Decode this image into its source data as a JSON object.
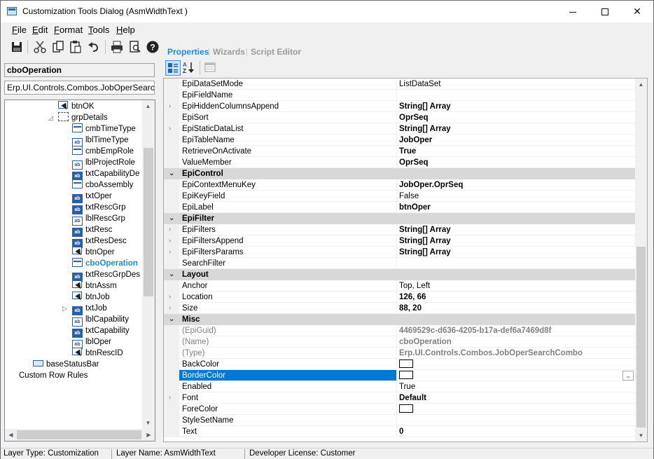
{
  "window": {
    "title": "Customization Tools Dialog  (AsmWidthText )"
  },
  "menu": [
    {
      "label": "File",
      "key": "F",
      "rest": "ile"
    },
    {
      "label": "Edit",
      "key": "E",
      "rest": "dit"
    },
    {
      "label": "Format",
      "key": "F",
      "rest": "ormat"
    },
    {
      "label": "Tools",
      "key": "T",
      "rest": "ools"
    },
    {
      "label": "Help",
      "key": "H",
      "rest": "elp"
    }
  ],
  "toolbar": {
    "buttons": [
      "save-icon",
      "cut-icon",
      "copy-icon",
      "paste-icon",
      "undo-icon",
      "print-icon",
      "print-preview-icon",
      "help-icon"
    ]
  },
  "left": {
    "control_name": "cboOperation",
    "control_type": "Erp.UI.Controls.Combos.JobOperSearch"
  },
  "tree": {
    "items": [
      {
        "label": "btnOK",
        "icon": "button-icon",
        "indent": 3
      },
      {
        "label": "grpDetails",
        "icon": "groupbox-icon",
        "indent": 3,
        "expander": "◿"
      },
      {
        "label": "cmbTimeType",
        "icon": "combo-icon",
        "indent": 4
      },
      {
        "label": "lblTimeType",
        "icon": "label-icon",
        "indent": 4
      },
      {
        "label": "cmbEmpRole",
        "icon": "combo-icon",
        "indent": 4
      },
      {
        "label": "lblProjectRole",
        "icon": "label-icon",
        "indent": 4
      },
      {
        "label": "txtCapabilityDe",
        "icon": "textbox-icon",
        "indent": 4
      },
      {
        "label": "cboAssembly",
        "icon": "combo-icon",
        "indent": 4
      },
      {
        "label": "txtOper",
        "icon": "textbox-icon",
        "indent": 4
      },
      {
        "label": "txtRescGrp",
        "icon": "textbox-icon",
        "indent": 4
      },
      {
        "label": "lblRescGrp",
        "icon": "label-icon",
        "indent": 4
      },
      {
        "label": "txtResc",
        "icon": "textbox-icon",
        "indent": 4
      },
      {
        "label": "txtResDesc",
        "icon": "textbox-icon",
        "indent": 4
      },
      {
        "label": "btnOper",
        "icon": "button-icon",
        "indent": 4
      },
      {
        "label": "cboOperation",
        "icon": "combo-icon",
        "indent": 4,
        "selected": true
      },
      {
        "label": "txtRescGrpDes",
        "icon": "textbox-icon",
        "indent": 4
      },
      {
        "label": "btnAssm",
        "icon": "button-icon",
        "indent": 4
      },
      {
        "label": "btnJob",
        "icon": "button-icon",
        "indent": 4
      },
      {
        "label": "txtJob",
        "icon": "textbox-icon",
        "indent": 4,
        "expander": "▷"
      },
      {
        "label": "lblCapability",
        "icon": "label-icon",
        "indent": 4
      },
      {
        "label": "txtCapability",
        "icon": "textbox-icon",
        "indent": 4
      },
      {
        "label": "lblOper",
        "icon": "label-icon",
        "indent": 4
      },
      {
        "label": "btnRescID",
        "icon": "button-icon",
        "indent": 4
      },
      {
        "label": "baseStatusBar",
        "icon": "statusbar-icon",
        "indent": 2
      },
      {
        "label": "Custom Row Rules",
        "icon": "",
        "indent": 1
      }
    ]
  },
  "tabs": [
    {
      "label": "Properties",
      "active": true
    },
    {
      "label": "Wizards",
      "active": false
    },
    {
      "label": "Script Editor",
      "active": false
    }
  ],
  "grid": {
    "rows": [
      {
        "type": "prop",
        "name": "EpiDataSetMode",
        "value": "ListDataSet"
      },
      {
        "type": "prop",
        "name": "EpiFieldName",
        "value": ""
      },
      {
        "type": "prop",
        "name": "EpiHiddenColumnsAppend",
        "value": "String[] Array",
        "bold": true,
        "expander": true
      },
      {
        "type": "prop",
        "name": "EpiSort",
        "value": "OprSeq",
        "bold": true
      },
      {
        "type": "prop",
        "name": "EpiStaticDataList",
        "value": "String[] Array",
        "bold": true,
        "expander": true
      },
      {
        "type": "prop",
        "name": "EpiTableName",
        "value": "JobOper",
        "bold": true
      },
      {
        "type": "prop",
        "name": "RetrieveOnActivate",
        "value": "True",
        "bold": true
      },
      {
        "type": "prop",
        "name": "ValueMember",
        "value": "OprSeq",
        "bold": true
      },
      {
        "type": "category",
        "name": "EpiControl"
      },
      {
        "type": "prop",
        "name": "EpiContextMenuKey",
        "value": "JobOper.OprSeq",
        "bold": true
      },
      {
        "type": "prop",
        "name": "EpiKeyField",
        "value": "False"
      },
      {
        "type": "prop",
        "name": "EpiLabel",
        "value": "btnOper",
        "bold": true
      },
      {
        "type": "category",
        "name": "EpiFilter"
      },
      {
        "type": "prop",
        "name": "EpiFilters",
        "value": "String[] Array",
        "bold": true,
        "expander": true
      },
      {
        "type": "prop",
        "name": "EpiFiltersAppend",
        "value": "String[] Array",
        "bold": true,
        "expander": true
      },
      {
        "type": "prop",
        "name": "EpiFiltersParams",
        "value": "String[] Array",
        "bold": true,
        "expander": true
      },
      {
        "type": "prop",
        "name": "SearchFilter",
        "value": ""
      },
      {
        "type": "category",
        "name": "Layout"
      },
      {
        "type": "prop",
        "name": "Anchor",
        "value": "Top, Left"
      },
      {
        "type": "prop",
        "name": "Location",
        "value": "126, 66",
        "bold": true,
        "expander": true
      },
      {
        "type": "prop",
        "name": "Size",
        "value": "88, 20",
        "bold": true,
        "expander": true
      },
      {
        "type": "category",
        "name": "Misc"
      },
      {
        "type": "prop",
        "name": "(EpiGuid)",
        "value": "4469529c-d636-4205-b17a-def6a7469d8f",
        "readonly": true,
        "bold": true
      },
      {
        "type": "prop",
        "name": "(Name)",
        "value": "cboOperation",
        "readonly": true,
        "bold": true
      },
      {
        "type": "prop",
        "name": "(Type)",
        "value": "Erp.UI.Controls.Combos.JobOperSearchCombo",
        "readonly": true,
        "bold": true
      },
      {
        "type": "prop",
        "name": "BackColor",
        "value": "",
        "swatch": true
      },
      {
        "type": "prop",
        "name": "BorderColor",
        "value": "",
        "swatch": true,
        "selected": true,
        "dropdown": true
      },
      {
        "type": "prop",
        "name": "Enabled",
        "value": "True"
      },
      {
        "type": "prop",
        "name": "Font",
        "value": "Default",
        "bold": true,
        "expander": true
      },
      {
        "type": "prop",
        "name": "ForeColor",
        "value": "",
        "swatch": true
      },
      {
        "type": "prop",
        "name": "StyleSetName",
        "value": ""
      },
      {
        "type": "prop",
        "name": "Text",
        "value": "0",
        "bold": true
      }
    ]
  },
  "statusbar": {
    "layer_type": "Layer Type:  Customization",
    "layer_name": "Layer Name:  AsmWidthText",
    "license": "Developer License:  Customer"
  }
}
